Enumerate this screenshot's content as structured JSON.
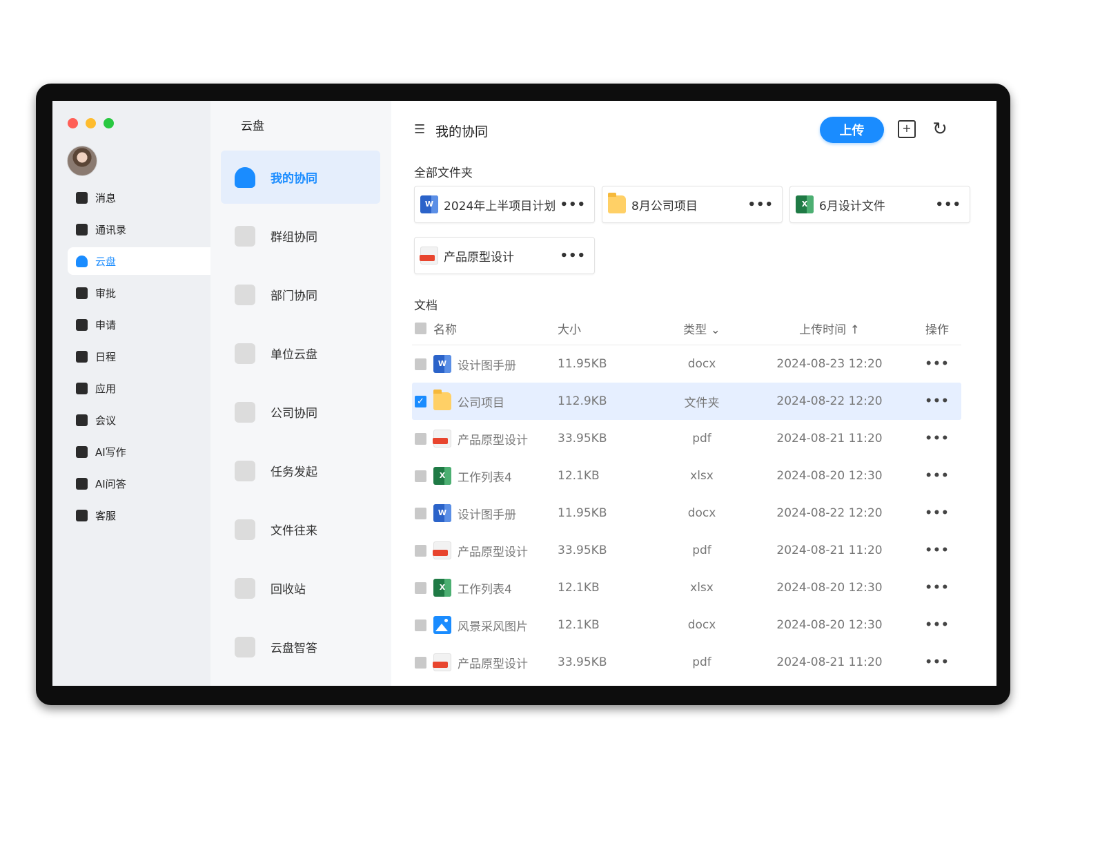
{
  "window": {
    "controls": [
      "close",
      "minimize",
      "maximize"
    ]
  },
  "nav": {
    "items": [
      {
        "label": "消息",
        "icon": "message-icon",
        "active": false
      },
      {
        "label": "通讯录",
        "icon": "contacts-icon",
        "active": false
      },
      {
        "label": "云盘",
        "icon": "cloud-icon",
        "active": true
      },
      {
        "label": "审批",
        "icon": "approval-icon",
        "active": false
      },
      {
        "label": "申请",
        "icon": "apply-icon",
        "active": false
      },
      {
        "label": "日程",
        "icon": "calendar-icon",
        "active": false
      },
      {
        "label": "应用",
        "icon": "apps-icon",
        "active": false
      },
      {
        "label": "会议",
        "icon": "meeting-icon",
        "active": false
      },
      {
        "label": "AI写作",
        "icon": "ai-write-icon",
        "active": false
      },
      {
        "label": "AI问答",
        "icon": "ai-qa-icon",
        "active": false
      },
      {
        "label": "客服",
        "icon": "support-icon",
        "active": false
      }
    ]
  },
  "sub": {
    "title": "云盘",
    "items": [
      {
        "label": "我的协同",
        "icon": "user-icon",
        "active": true
      },
      {
        "label": "群组协同",
        "icon": "group-icon",
        "active": false
      },
      {
        "label": "部门协同",
        "icon": "department-icon",
        "active": false
      },
      {
        "label": "单位云盘",
        "icon": "home-icon",
        "active": false
      },
      {
        "label": "公司协同",
        "icon": "building-icon",
        "active": false
      },
      {
        "label": "任务发起",
        "icon": "task-icon",
        "active": false
      },
      {
        "label": "文件往来",
        "icon": "file-exchange-icon",
        "active": false
      },
      {
        "label": "回收站",
        "icon": "trash-icon",
        "active": false
      },
      {
        "label": "云盘智答",
        "icon": "robot-icon",
        "active": false
      }
    ]
  },
  "main": {
    "title": "我的协同",
    "upload_label": "上传",
    "folders_label": "全部文件夹",
    "folders": [
      {
        "name": "2024年上半项目计划",
        "type": "word"
      },
      {
        "name": "8月公司项目",
        "type": "folder"
      },
      {
        "name": "6月设计文件",
        "type": "excel"
      },
      {
        "name": "产品原型设计",
        "type": "pdf"
      }
    ],
    "more_glyph": "•••",
    "docs_label": "文档",
    "columns": {
      "name": "名称",
      "size": "大小",
      "type": "类型",
      "time": "上传时间",
      "op": "操作"
    },
    "rows": [
      {
        "name": "设计图手册",
        "icon": "word",
        "size": "11.95KB",
        "type": "docx",
        "time": "2024-08-23 12:20",
        "selected": false
      },
      {
        "name": "公司项目",
        "icon": "folder",
        "size": "112.9KB",
        "type": "文件夹",
        "time": "2024-08-22 12:20",
        "selected": true
      },
      {
        "name": "产品原型设计",
        "icon": "pdf",
        "size": "33.95KB",
        "type": "pdf",
        "time": "2024-08-21 11:20",
        "selected": false
      },
      {
        "name": "工作列表4",
        "icon": "excel",
        "size": "12.1KB",
        "type": "xlsx",
        "time": "2024-08-20 12:30",
        "selected": false
      },
      {
        "name": "设计图手册",
        "icon": "word",
        "size": "11.95KB",
        "type": "docx",
        "time": "2024-08-22 12:20",
        "selected": false
      },
      {
        "name": "产品原型设计",
        "icon": "pdf",
        "size": "33.95KB",
        "type": "pdf",
        "time": "2024-08-21 11:20",
        "selected": false
      },
      {
        "name": "工作列表4",
        "icon": "excel",
        "size": "12.1KB",
        "type": "xlsx",
        "time": "2024-08-20 12:30",
        "selected": false
      },
      {
        "name": "风景采风图片",
        "icon": "image",
        "size": "12.1KB",
        "type": "docx",
        "time": "2024-08-20 12:30",
        "selected": false
      },
      {
        "name": "产品原型设计",
        "icon": "pdf",
        "size": "33.95KB",
        "type": "pdf",
        "time": "2024-08-21 11:20",
        "selected": false
      }
    ]
  },
  "colors": {
    "accent": "#1a8cff",
    "close": "#ff5f57",
    "minimize": "#febc2e",
    "maximize": "#28c840",
    "selected_row": "#e6efff"
  }
}
